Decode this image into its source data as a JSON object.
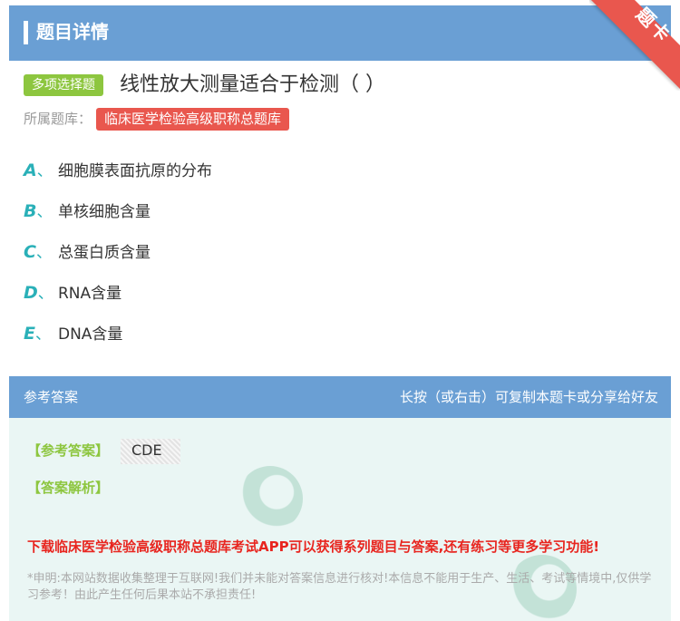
{
  "header": {
    "title": "题目详情"
  },
  "ribbon": {
    "label": "题卡"
  },
  "question": {
    "type_badge": "多项选择题",
    "text": "线性放大测量适合于检测（ ）",
    "bank_label": "所属题库：",
    "bank_name": "临床医学检验高级职称总题库"
  },
  "options": [
    {
      "letter": "A",
      "sep": "、",
      "text": "细胞膜表面抗原的分布"
    },
    {
      "letter": "B",
      "sep": "、",
      "text": "单核细胞含量"
    },
    {
      "letter": "C",
      "sep": "、",
      "text": "总蛋白质含量"
    },
    {
      "letter": "D",
      "sep": "、",
      "text": "RNA含量"
    },
    {
      "letter": "E",
      "sep": "、",
      "text": "DNA含量"
    }
  ],
  "answer_panel": {
    "title": "参考答案",
    "hint": "长按（或右击）可复制本题卡或分享给好友",
    "answer_label": "【参考答案】",
    "answer_value": "CDE",
    "explanation_label": "【答案解析】",
    "promo": "下载临床医学检验高级职称总题库考试APP可以获得系列题目与答案,还有练习等更多学习功能!",
    "disclaimer": "*申明:本网站数据收集整理于互联网!我们并未能对答案信息进行核对!本信息不能用于生产、生活、考试等情境中,仅供学习参考！由此产生任何后果本站不承担责任!"
  },
  "colors": {
    "header_bg": "#6a9fd4",
    "ribbon_bg": "#e9574e",
    "type_badge_bg": "#8dc63f",
    "bank_badge_bg": "#e9574e",
    "option_letter": "#2ab0b8",
    "answer_bg": "#eaf6f4",
    "promo_text": "#e8251f"
  }
}
